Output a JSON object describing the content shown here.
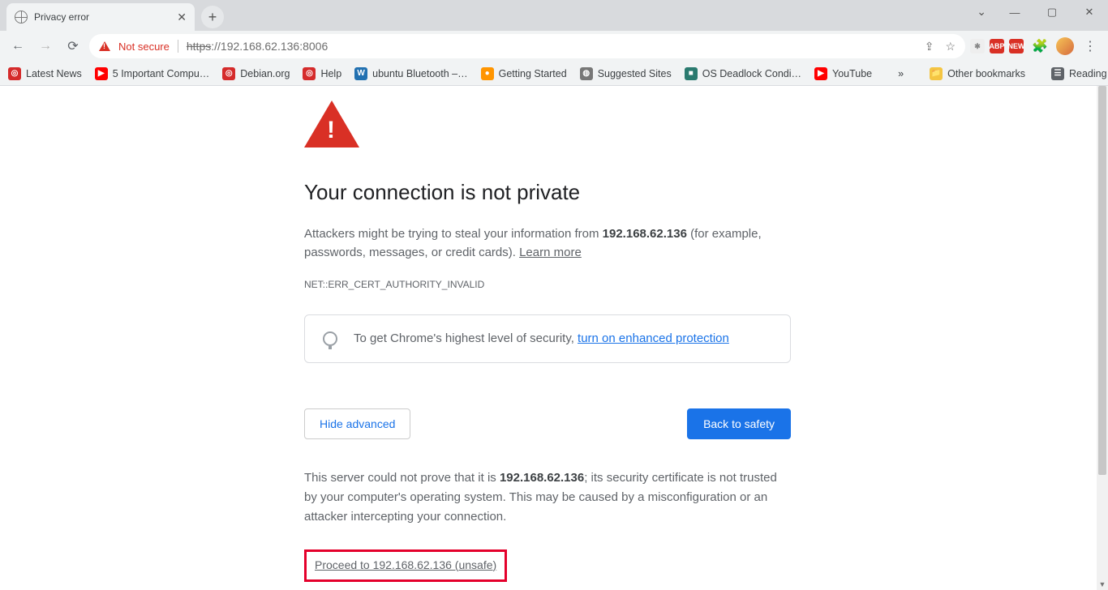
{
  "window": {
    "tab_title": "Privacy error",
    "win_min": "—",
    "win_max": "▢",
    "win_close": "✕",
    "tabs_chevron": "⌄"
  },
  "toolbar": {
    "not_secure": "Not secure",
    "url_scheme": "https",
    "url_rest": "://192.168.62.136:8006"
  },
  "bookmarks": [
    {
      "icon_bg": "#d52b2b",
      "icon_txt": "◎",
      "label": "Latest News"
    },
    {
      "icon_bg": "#ff0000",
      "icon_txt": "▶",
      "label": "5 Important Compu…"
    },
    {
      "icon_bg": "#d52b2b",
      "icon_txt": "◎",
      "label": "Debian.org"
    },
    {
      "icon_bg": "#d52b2b",
      "icon_txt": "◎",
      "label": "Help"
    },
    {
      "icon_bg": "#2271b1",
      "icon_txt": "W",
      "label": "ubuntu Bluetooth –…"
    },
    {
      "icon_bg": "#ff9500",
      "icon_txt": "●",
      "label": "Getting Started"
    },
    {
      "icon_bg": "#777",
      "icon_txt": "◍",
      "label": "Suggested Sites"
    },
    {
      "icon_bg": "#2a7a6f",
      "icon_txt": "■",
      "label": "OS Deadlock Condi…"
    },
    {
      "icon_bg": "#ff0000",
      "icon_txt": "▶",
      "label": "YouTube"
    }
  ],
  "bookmarks_right": {
    "other": "Other bookmarks",
    "reading": "Reading list"
  },
  "page": {
    "heading": "Your connection is not private",
    "p1a": "Attackers might be trying to steal your information from ",
    "p1b": "192.168.62.136",
    "p1c": " (for example, passwords, messages, or credit cards). ",
    "learn_more": "Learn more",
    "error_code": "NET::ERR_CERT_AUTHORITY_INVALID",
    "tip_a": "To get Chrome's highest level of security, ",
    "tip_link": "turn on enhanced protection",
    "hide_adv": "Hide advanced",
    "safety": "Back to safety",
    "adv_a": "This server could not prove that it is ",
    "adv_b": "192.168.62.136",
    "adv_c": "; its security certificate is not trusted by your computer's operating system. This may be caused by a misconfiguration or an attacker intercepting your connection.",
    "proceed": "Proceed to 192.168.62.136 (unsafe)"
  }
}
